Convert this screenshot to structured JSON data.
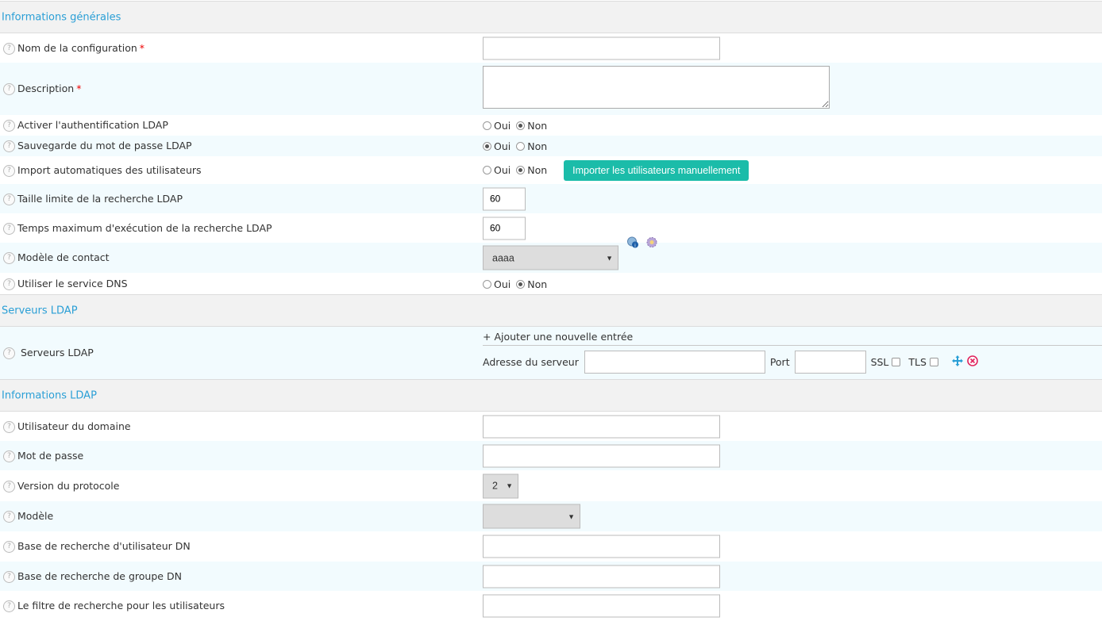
{
  "sections": {
    "general": "Informations générales",
    "servers": "Serveurs LDAP",
    "ldap_info": "Informations LDAP"
  },
  "help_glyph": "?",
  "required_mark": "*",
  "radio": {
    "yes": "Oui",
    "no": "Non"
  },
  "general": {
    "config_name": {
      "label": "Nom de la configuration",
      "value": ""
    },
    "description": {
      "label": "Description",
      "value": ""
    },
    "enable_auth": {
      "label": "Activer l'authentification LDAP",
      "selected": "Non"
    },
    "store_password": {
      "label": "Sauvegarde du mot de passe LDAP",
      "selected": "Oui"
    },
    "auto_import": {
      "label": "Import automatiques des utilisateurs",
      "selected": "Non",
      "button": "Importer les utilisateurs manuellement"
    },
    "size_limit": {
      "label": "Taille limite de la recherche LDAP",
      "value": "60"
    },
    "max_time": {
      "label": "Temps maximum d'exécution de la recherche LDAP",
      "value": "60"
    },
    "contact_template": {
      "label": "Modèle de contact",
      "value": "aaaa"
    },
    "dns": {
      "label": "Utiliser le service DNS",
      "selected": "Non"
    }
  },
  "servers": {
    "label": "Serveurs LDAP",
    "add_entry": "+ Ajouter une nouvelle entrée",
    "address_label": "Adresse du serveur",
    "port_label": "Port",
    "ssl_label": "SSL",
    "tls_label": "TLS"
  },
  "ldap": {
    "domain_user": {
      "label": "Utilisateur du domaine",
      "value": ""
    },
    "password": {
      "label": "Mot de passe",
      "value": ""
    },
    "protocol": {
      "label": "Version du protocole",
      "value": "2"
    },
    "model": {
      "label": "Modèle",
      "value": ""
    },
    "user_base_dn": {
      "label": "Base de recherche d'utilisateur DN",
      "value": ""
    },
    "group_base_dn": {
      "label": "Base de recherche de groupe DN",
      "value": ""
    },
    "user_filter": {
      "label": "Le filtre de recherche pour les utilisateurs",
      "value": ""
    }
  },
  "colors": {
    "section_title": "#2a9fd6",
    "button": "#1bbca9",
    "required": "#e00000"
  }
}
